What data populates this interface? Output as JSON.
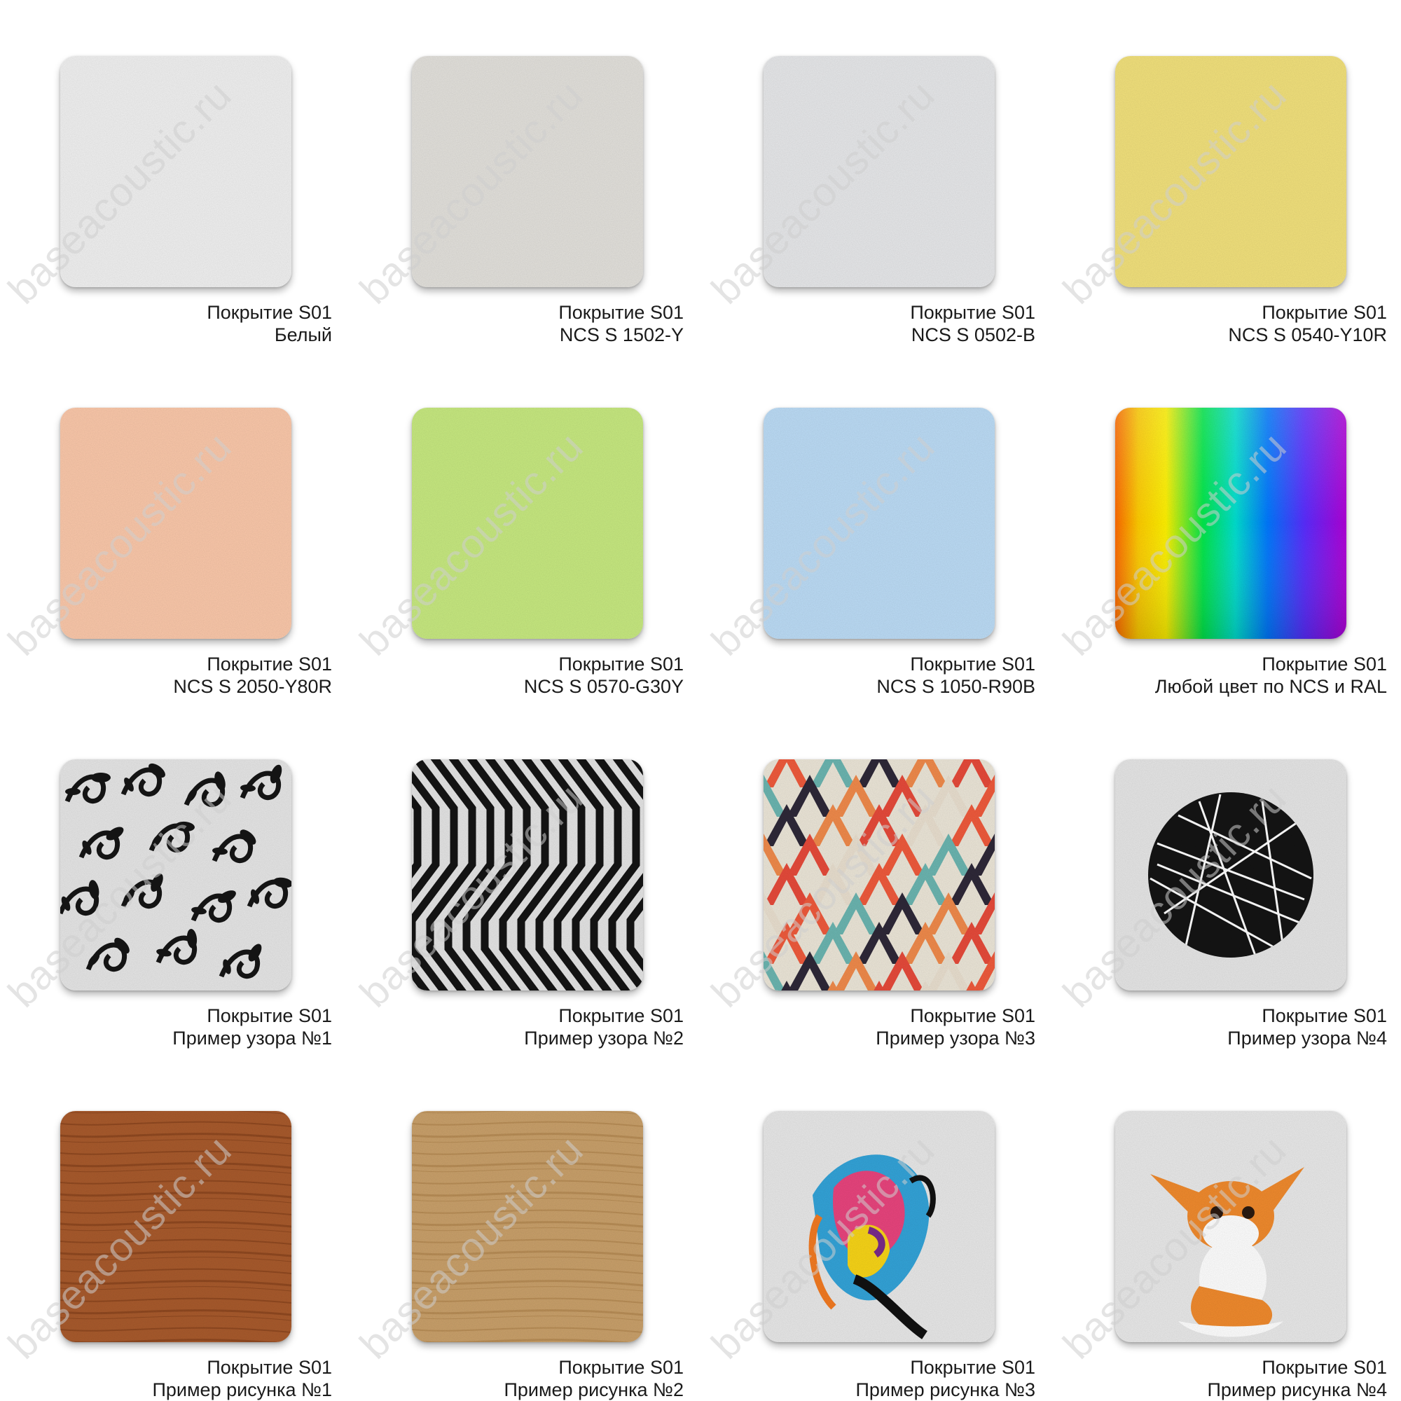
{
  "watermark": "baseacoustic.ru",
  "swatches": [
    {
      "title": "Покрытие S01",
      "subtitle": "Белый",
      "color": "#f1f1f1",
      "kind": "solid"
    },
    {
      "title": "Покрытие S01",
      "subtitle": "NCS S 1502-Y",
      "color": "#e3e1dc",
      "kind": "solid"
    },
    {
      "title": "Покрытие S01",
      "subtitle": "NCS S 0502-B",
      "color": "#e7e8ea",
      "kind": "solid"
    },
    {
      "title": "Покрытие S01",
      "subtitle": "NCS S 0540-Y10R",
      "color": "#f2e17c",
      "kind": "solid"
    },
    {
      "title": "Покрытие S01",
      "subtitle": "NCS S 2050-Y80R",
      "color": "#fbc8aa",
      "kind": "solid"
    },
    {
      "title": "Покрытие S01",
      "subtitle": "NCS S 0570-G30Y",
      "color": "#c7e980",
      "kind": "solid"
    },
    {
      "title": "Покрытие S01",
      "subtitle": "NCS S 1050-R90B",
      "color": "#bcdcf6",
      "kind": "solid"
    },
    {
      "title": "Покрытие S01",
      "subtitle": "Любой цвет по NCS и RAL",
      "color": "",
      "kind": "rainbow"
    },
    {
      "title": "Покрытие S01",
      "subtitle": "Пример узора №1",
      "color": "",
      "kind": "floral"
    },
    {
      "title": "Покрытие S01",
      "subtitle": "Пример узора №2",
      "color": "",
      "kind": "stripes"
    },
    {
      "title": "Покрытие S01",
      "subtitle": "Пример узора №3",
      "color": "",
      "kind": "chevron"
    },
    {
      "title": "Покрытие S01",
      "subtitle": "Пример узора №4",
      "color": "",
      "kind": "circle"
    },
    {
      "title": "Покрытие S01",
      "subtitle": "Пример рисунка №1",
      "color": "#a85a2c",
      "kind": "wood-dark"
    },
    {
      "title": "Покрытие S01",
      "subtitle": "Пример рисунка №2",
      "color": "#c9a06a",
      "kind": "wood-light"
    },
    {
      "title": "Покрытие S01",
      "subtitle": "Пример рисунка №3",
      "color": "",
      "kind": "face"
    },
    {
      "title": "Покрытие S01",
      "subtitle": "Пример рисунка №4",
      "color": "",
      "kind": "fox"
    }
  ]
}
